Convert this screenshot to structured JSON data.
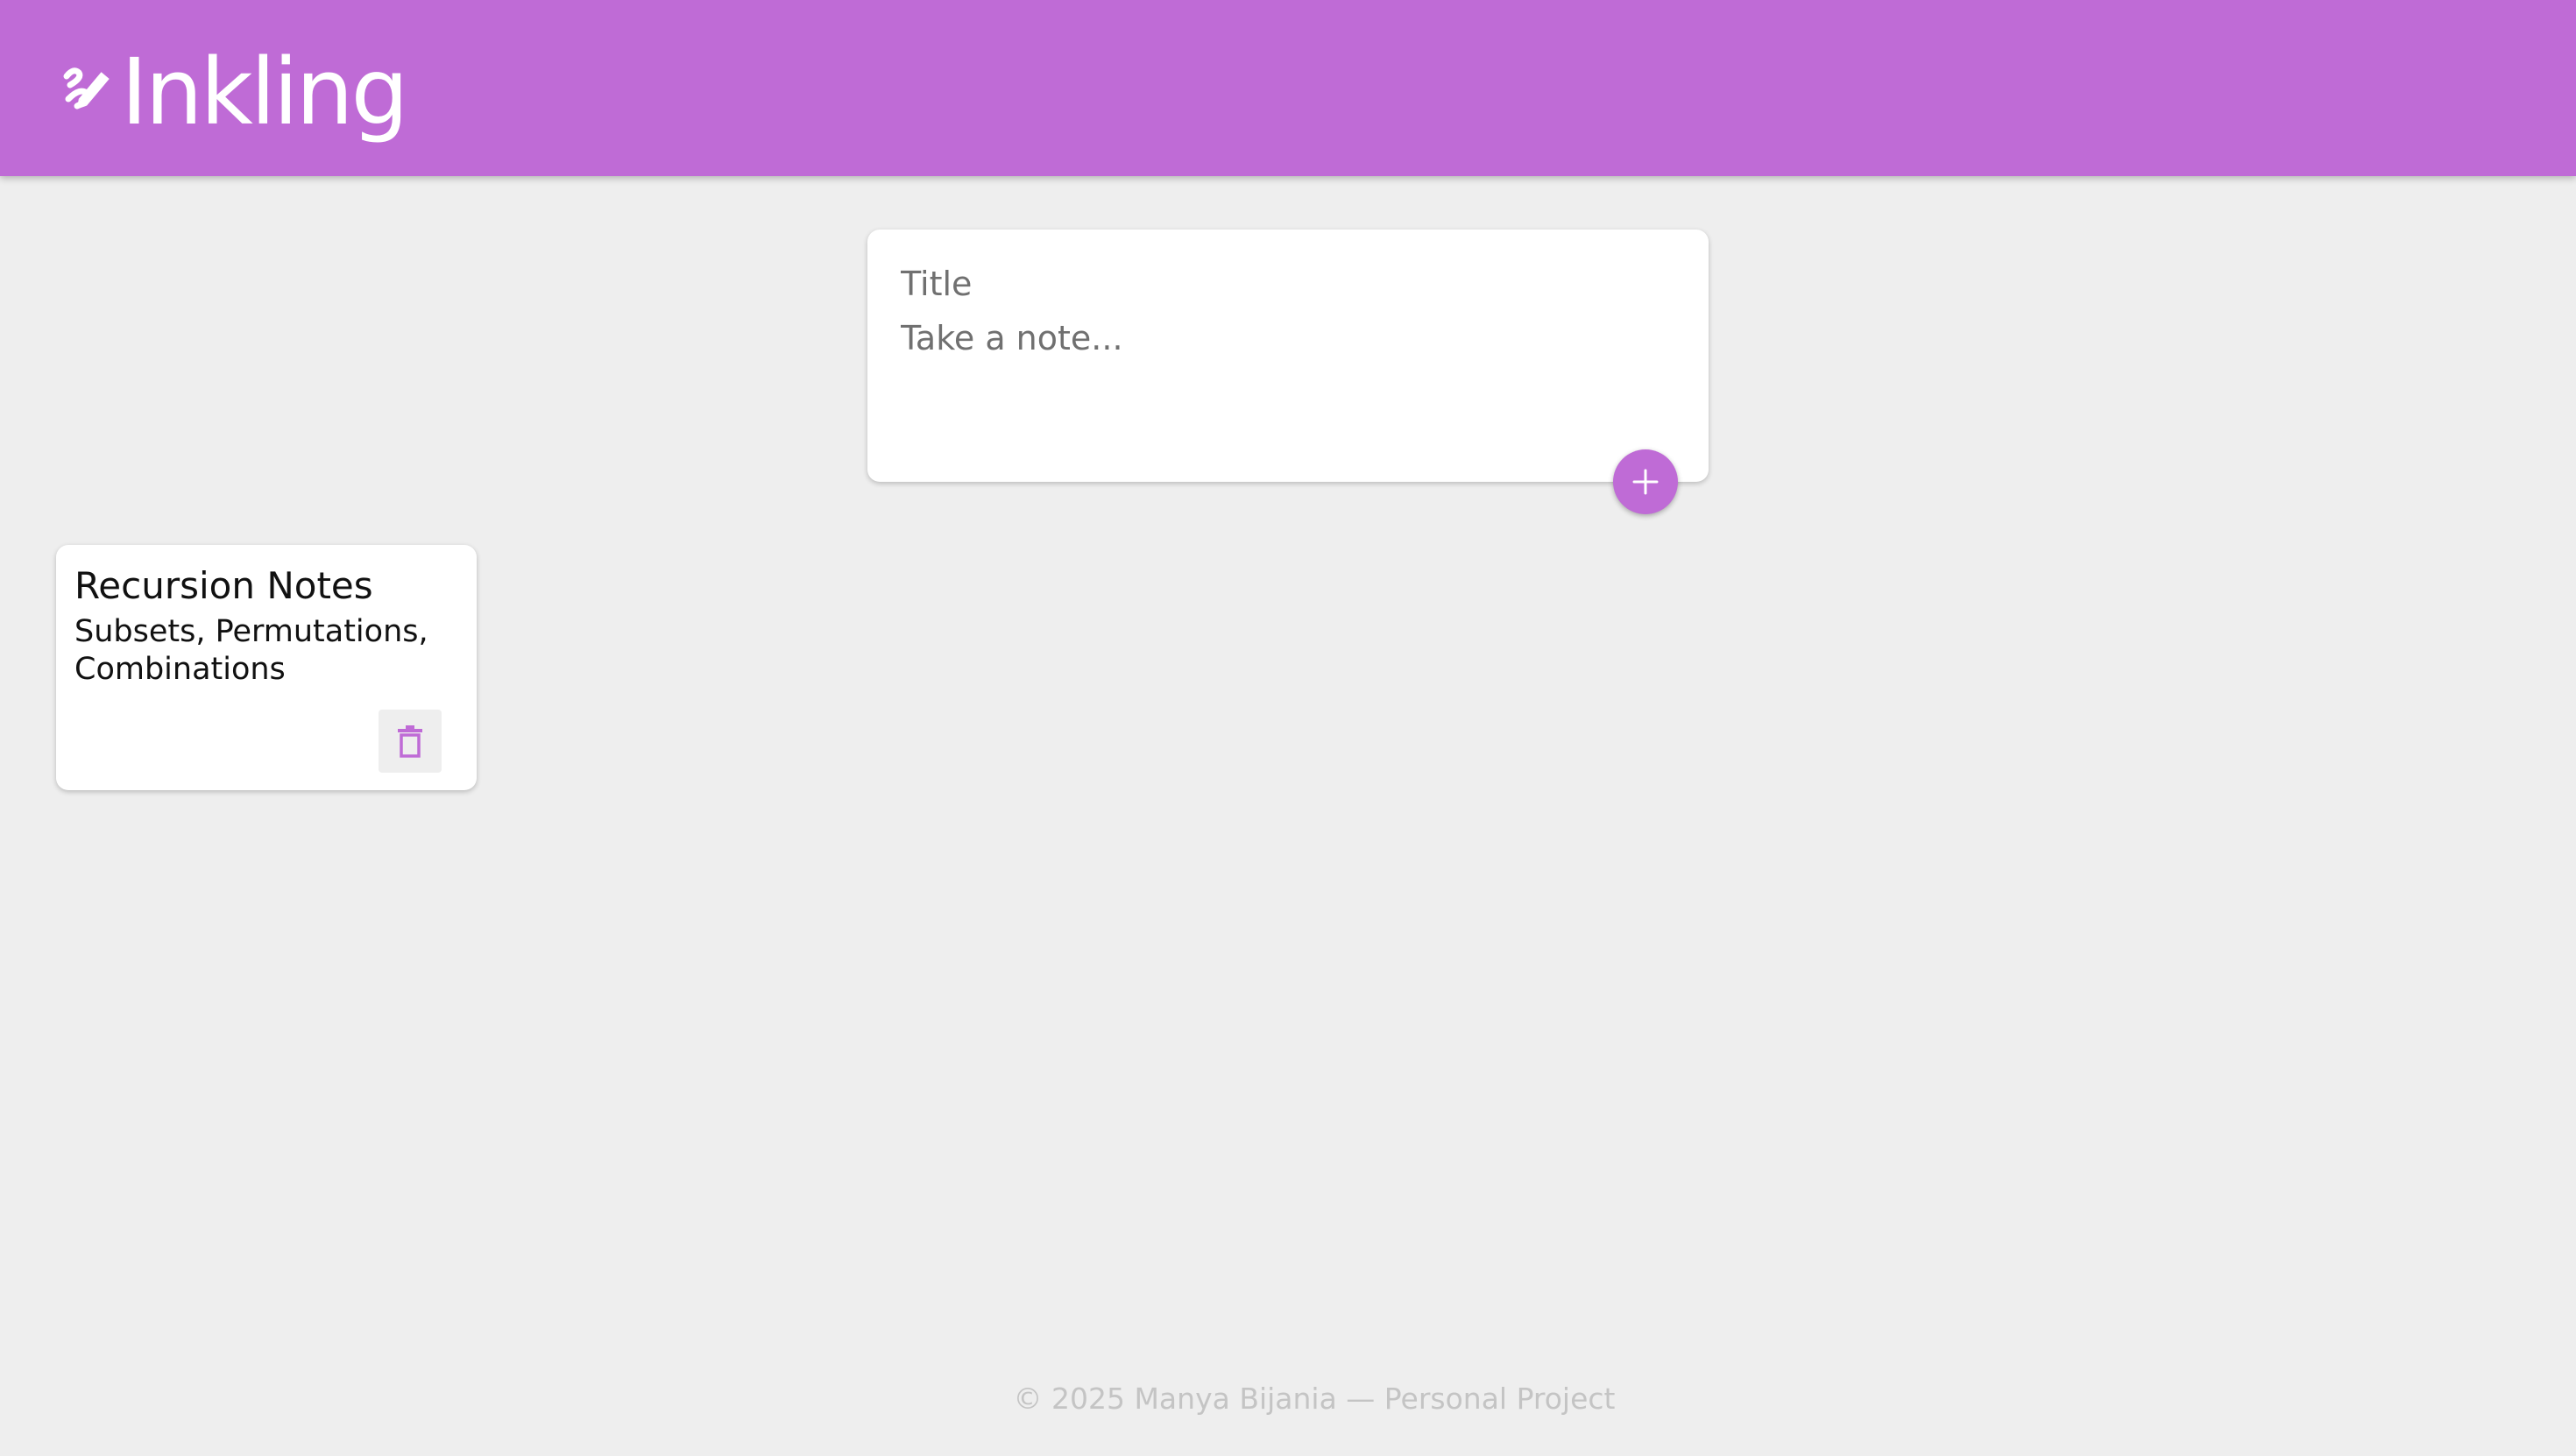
{
  "app": {
    "name": "Inkling",
    "logo_icon": "pencil-scribble-icon"
  },
  "composer": {
    "title_placeholder": "Title",
    "note_placeholder": "Take a note...",
    "add_icon": "plus-icon"
  },
  "notes": [
    {
      "title": "Recursion Notes",
      "content": "Subsets, Permutations, Combinations",
      "delete_icon": "trash-icon"
    }
  ],
  "footer": {
    "text": "© 2025 Manya Bijania — Personal Project"
  },
  "colors": {
    "accent": "#bf6bd6",
    "background": "#eeeeee",
    "card": "#ffffff",
    "footer_text": "#c4c4c4"
  }
}
